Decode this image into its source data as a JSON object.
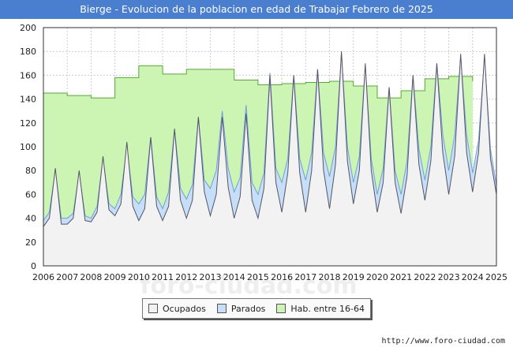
{
  "title": "Bierge - Evolucion de la poblacion en edad de Trabajar Febrero de 2025",
  "source": "http://www.foro-ciudad.com",
  "watermark": "foro-ciudad.com",
  "colors": {
    "title_bg": "#4a7fd0",
    "hab_fill": "#ccf5b4",
    "hab_line": "#55aa33",
    "parados_fill": "#c6def7",
    "parados_line": "#6f9fd8",
    "ocupados_fill": "#f2f2f2",
    "ocupados_line": "#555566"
  },
  "chart_data": {
    "type": "area",
    "title": "Bierge - Evolucion de la poblacion en edad de Trabajar Febrero de 2025",
    "ylim": [
      0,
      200
    ],
    "yticks": [
      0,
      20,
      40,
      60,
      80,
      100,
      120,
      140,
      160,
      180,
      200
    ],
    "xlim": [
      2006,
      2025
    ],
    "xticks": [
      "2006",
      "2007",
      "2008",
      "2009",
      "2010",
      "2011",
      "2012",
      "2013",
      "2014",
      "2015",
      "2016",
      "2017",
      "2018",
      "2019",
      "2020",
      "2021",
      "2022",
      "2023",
      "2024",
      "2025"
    ],
    "grid": true,
    "legend_position": "bottom",
    "series": [
      {
        "name": "Hab. entre 16-64",
        "x": [
          2006,
          2007,
          2007,
          2008,
          2008,
          2009,
          2009,
          2010,
          2010,
          2011,
          2011,
          2012,
          2012,
          2013,
          2013,
          2014,
          2014,
          2015,
          2015,
          2016,
          2016,
          2017,
          2017,
          2018,
          2018,
          2019,
          2019,
          2020,
          2020,
          2021,
          2021,
          2022,
          2022,
          2023,
          2023,
          2024,
          2024
        ],
        "values": [
          145,
          145,
          143,
          143,
          141,
          141,
          158,
          158,
          168,
          168,
          161,
          161,
          165,
          165,
          165,
          165,
          156,
          156,
          152,
          152,
          153,
          153,
          154,
          154,
          155,
          155,
          151,
          151,
          141,
          141,
          147,
          147,
          157,
          157,
          159,
          159,
          155
        ]
      },
      {
        "name": "Parados",
        "x": [
          2006,
          2006.25,
          2006.5,
          2006.75,
          2007,
          2007.25,
          2007.5,
          2007.75,
          2008,
          2008.25,
          2008.5,
          2008.75,
          2009,
          2009.25,
          2009.5,
          2009.75,
          2010,
          2010.25,
          2010.5,
          2010.75,
          2011,
          2011.25,
          2011.5,
          2011.75,
          2012,
          2012.25,
          2012.5,
          2012.75,
          2013,
          2013.25,
          2013.5,
          2013.75,
          2014,
          2014.25,
          2014.5,
          2014.75,
          2015,
          2015.25,
          2015.5,
          2015.75,
          2016,
          2016.25,
          2016.5,
          2016.75,
          2017,
          2017.25,
          2017.5,
          2017.75,
          2018,
          2018.25,
          2018.5,
          2018.75,
          2019,
          2019.25,
          2019.5,
          2019.75,
          2020,
          2020.25,
          2020.5,
          2020.75,
          2021,
          2021.25,
          2021.5,
          2021.75,
          2022,
          2022.25,
          2022.5,
          2022.75,
          2023,
          2023.25,
          2023.5,
          2023.75,
          2024,
          2024.25,
          2024.5,
          2024.75,
          2025
        ],
        "values": [
          38,
          45,
          80,
          40,
          40,
          44,
          78,
          42,
          40,
          50,
          90,
          52,
          48,
          60,
          100,
          58,
          52,
          60,
          108,
          58,
          48,
          62,
          115,
          65,
          56,
          68,
          125,
          72,
          65,
          80,
          130,
          82,
          62,
          74,
          135,
          70,
          60,
          78,
          162,
          82,
          70,
          90,
          160,
          90,
          72,
          95,
          165,
          95,
          75,
          100,
          178,
          100,
          70,
          92,
          168,
          90,
          60,
          82,
          150,
          80,
          60,
          88,
          160,
          98,
          72,
          100,
          170,
          110,
          80,
          110,
          175,
          110,
          78,
          105,
          175,
          98,
          68
        ]
      },
      {
        "name": "Ocupados",
        "x": [
          2006,
          2006.25,
          2006.5,
          2006.75,
          2007,
          2007.25,
          2007.5,
          2007.75,
          2008,
          2008.25,
          2008.5,
          2008.75,
          2009,
          2009.25,
          2009.5,
          2009.75,
          2010,
          2010.25,
          2010.5,
          2010.75,
          2011,
          2011.25,
          2011.5,
          2011.75,
          2012,
          2012.25,
          2012.5,
          2012.75,
          2013,
          2013.25,
          2013.5,
          2013.75,
          2014,
          2014.25,
          2014.5,
          2014.75,
          2015,
          2015.25,
          2015.5,
          2015.75,
          2016,
          2016.25,
          2016.5,
          2016.75,
          2017,
          2017.25,
          2017.5,
          2017.75,
          2018,
          2018.25,
          2018.5,
          2018.75,
          2019,
          2019.25,
          2019.5,
          2019.75,
          2020,
          2020.25,
          2020.5,
          2020.75,
          2021,
          2021.25,
          2021.5,
          2021.75,
          2022,
          2022.25,
          2022.5,
          2022.75,
          2023,
          2023.25,
          2023.5,
          2023.75,
          2024,
          2024.25,
          2024.5,
          2024.75,
          2025
        ],
        "values": [
          33,
          40,
          82,
          35,
          35,
          40,
          80,
          38,
          37,
          45,
          92,
          47,
          42,
          52,
          104,
          50,
          38,
          48,
          108,
          50,
          38,
          50,
          115,
          55,
          40,
          55,
          125,
          62,
          42,
          60,
          125,
          66,
          40,
          58,
          128,
          55,
          40,
          65,
          160,
          70,
          45,
          78,
          160,
          78,
          45,
          80,
          165,
          80,
          48,
          85,
          180,
          88,
          52,
          80,
          170,
          80,
          45,
          70,
          150,
          70,
          44,
          75,
          160,
          85,
          55,
          88,
          170,
          95,
          60,
          92,
          178,
          95,
          62,
          95,
          178,
          90,
          60
        ]
      }
    ]
  }
}
